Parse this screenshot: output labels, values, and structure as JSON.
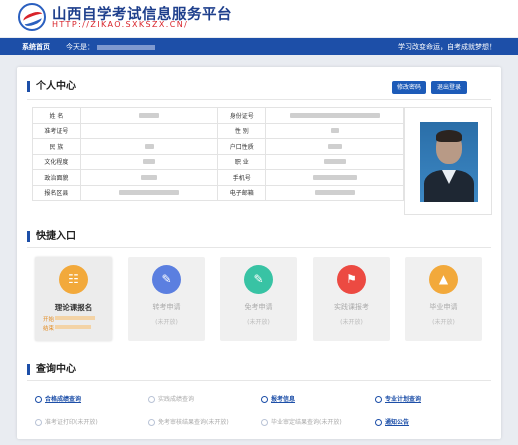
{
  "header": {
    "title": "山西自学考试信息服务平台",
    "url": "HTTP://ZIKAO.SXKSZX.CN/"
  },
  "nav": {
    "home": "系统首页",
    "today_label": "今天是：",
    "slogan": "学习改变命运，自考成就梦想！"
  },
  "profile": {
    "section_title": "个人中心",
    "buttons": [
      "修改密码",
      "退出登录"
    ],
    "rows": [
      {
        "l1": "姓    名",
        "l2": "身份证号"
      },
      {
        "l1": "准考证号",
        "l2": "性    别"
      },
      {
        "l1": "民    族",
        "l2": "户口性质"
      },
      {
        "l1": "文化程度",
        "l2": "职    业"
      },
      {
        "l1": "政治面貌",
        "l2": "手机号"
      },
      {
        "l1": "报名区县",
        "l2": "电子邮箱"
      }
    ]
  },
  "quick": {
    "section_title": "快捷入口",
    "cards": [
      {
        "label": "理论课报名",
        "status": "",
        "note1": "开始",
        "note2": "结束",
        "color": "#f2a93b",
        "icon": "calendar-icon"
      },
      {
        "label": "转考申请",
        "status": "(未开放)",
        "color": "#5b7fe0",
        "icon": "document-edit-icon"
      },
      {
        "label": "免考申请",
        "status": "(未开放)",
        "color": "#38c3a4",
        "icon": "form-edit-icon"
      },
      {
        "label": "实践课报考",
        "status": "(未开放)",
        "color": "#ec4a42",
        "icon": "flag-icon"
      },
      {
        "label": "毕业申请",
        "status": "(未开放)",
        "color": "#f2a93b",
        "icon": "graduation-cap-icon"
      }
    ]
  },
  "query": {
    "section_title": "查询中心",
    "items": [
      {
        "label": "合格成绩查询",
        "enabled": true
      },
      {
        "label": "实践成绩查询",
        "enabled": false
      },
      {
        "label": "报考信息",
        "enabled": true
      },
      {
        "label": "专业计划查询",
        "enabled": true
      },
      {
        "label": "准考证打印(未开放)",
        "enabled": false
      },
      {
        "label": "免考审核结果查询(未开放)",
        "enabled": false
      },
      {
        "label": "毕业审定结果查询(未开放)",
        "enabled": false
      },
      {
        "label": "通知公告",
        "enabled": true
      }
    ]
  }
}
